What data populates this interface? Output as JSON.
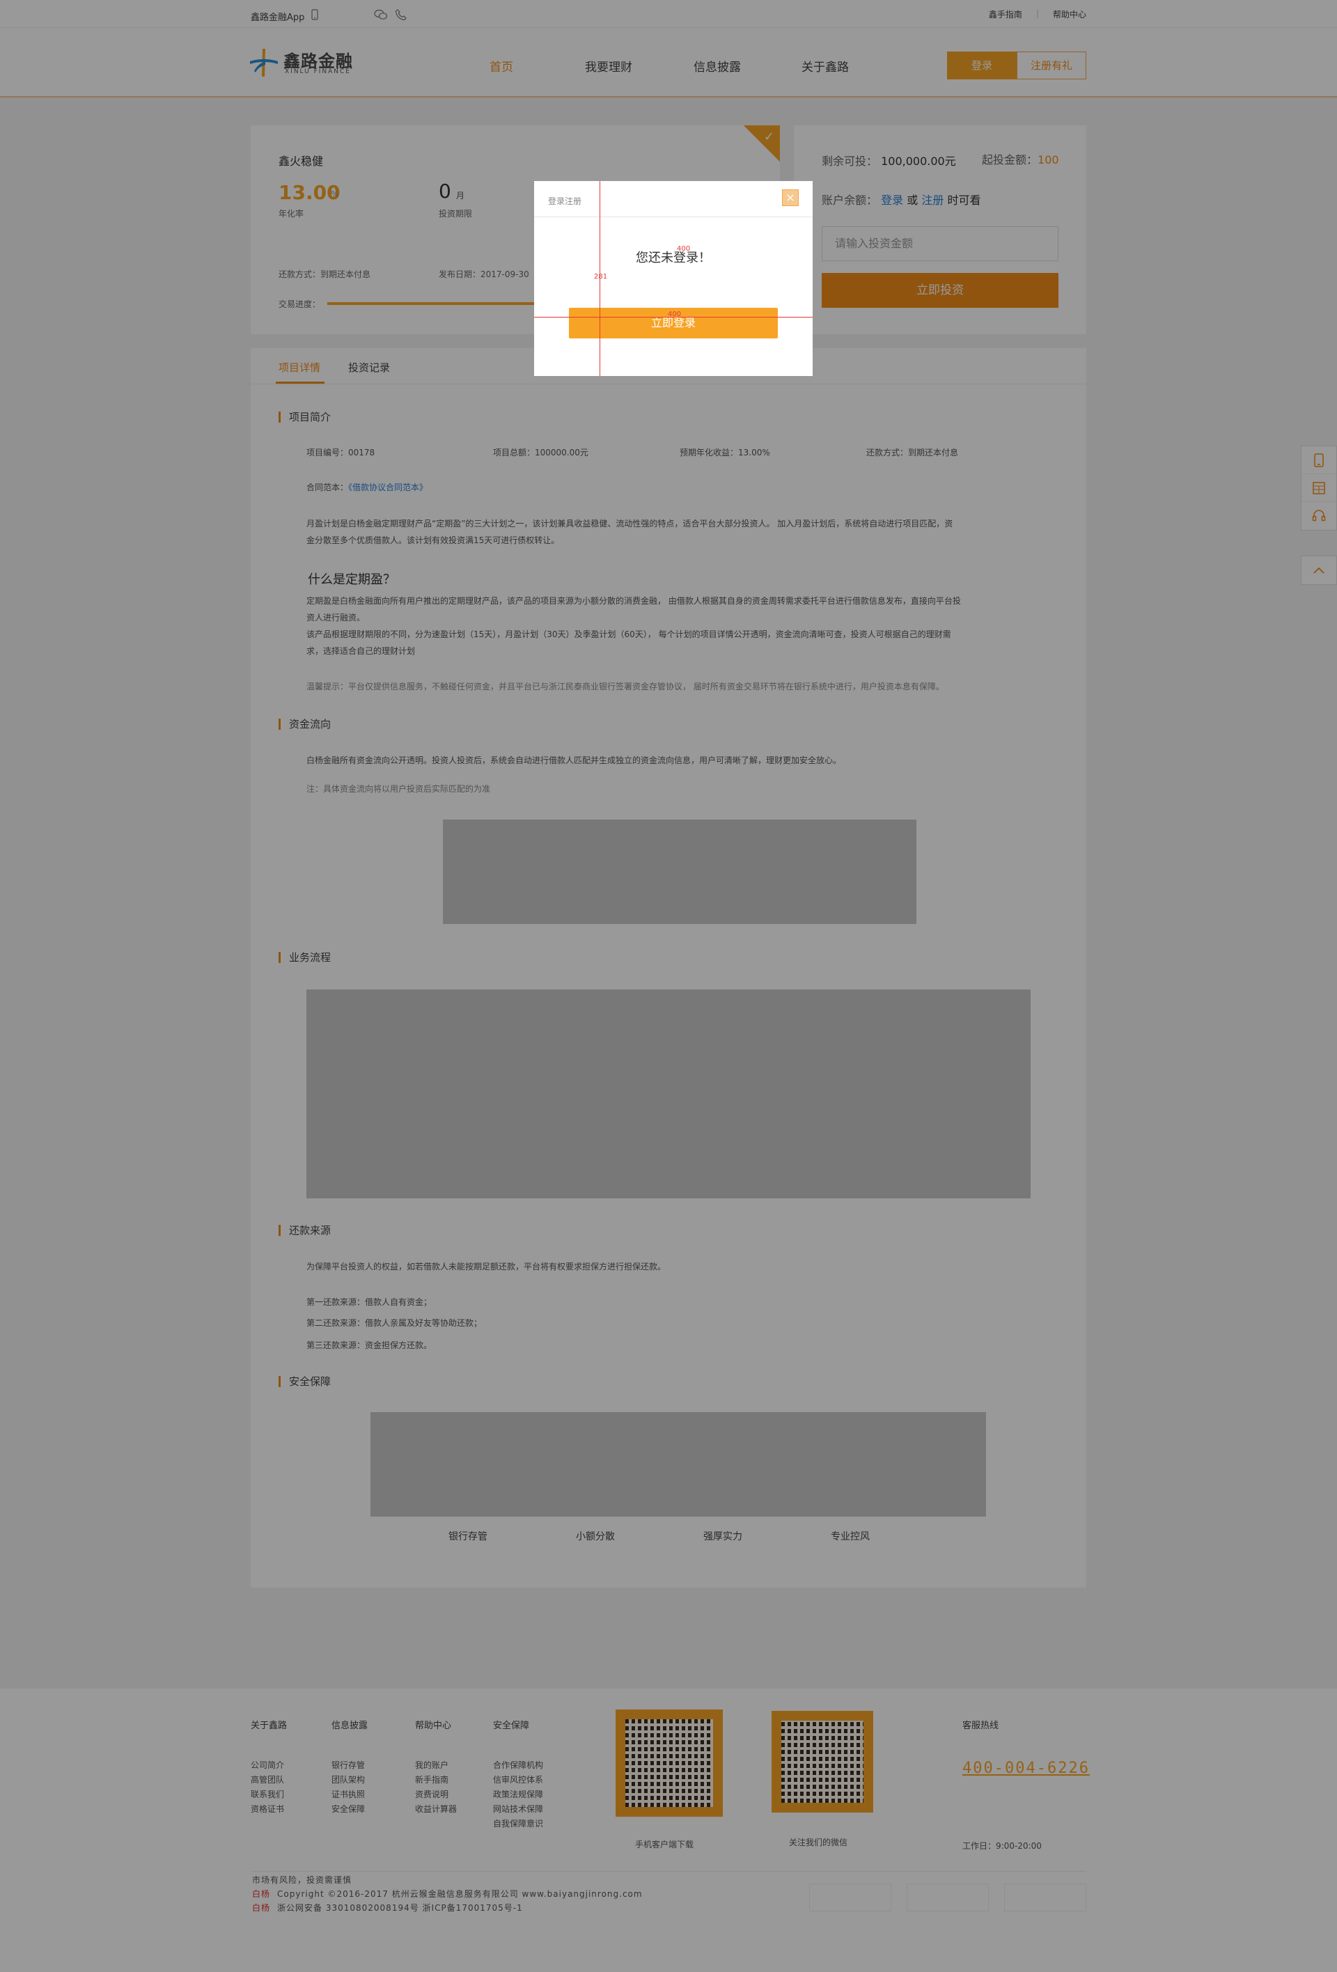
{
  "topbar": {
    "app_label": "鑫路金融App",
    "guide_label": "鑫手指南",
    "help_label": "帮助中心"
  },
  "header": {
    "logo_cn": "鑫路金融",
    "logo_en": "XINLU FINANCE",
    "nav": [
      "首页",
      "我要理财",
      "信息披露",
      "关于鑫路"
    ],
    "login_label": "登录",
    "register_label": "注册有礼"
  },
  "product": {
    "name": "鑫火稳健",
    "rate": "13.00",
    "rate_unit": "%",
    "rate_label": "年化率",
    "term": "0",
    "term_unit": "月",
    "term_label": "投资期限",
    "repay_method": "还款方式：到期还本付息",
    "publish_date": "发布日期：2017-09-30",
    "progress_label": "交易进度：",
    "progress_fraction": 0.7
  },
  "invest": {
    "remaining_label": "剩余可投：",
    "remaining_value": "100,000.00元",
    "min_label": "起投金额：",
    "min_value": "100",
    "balance_label": "账户余额：",
    "login_link": "登录",
    "or": "或",
    "register_link": "注册",
    "visible_suffix": "时可看",
    "input_placeholder": "请输入投资金额",
    "invest_button": "立即投资"
  },
  "tabs": [
    "项目详情",
    "投资记录"
  ],
  "detail": {
    "intro_title": "项目简介",
    "project_no": "项目编号：00178",
    "total": "项目总额：100000.00元",
    "expected_rate": "预期年化收益：13.00%",
    "repay": "还款方式：到期还本付息",
    "contract_label": "合同范本：",
    "contract_link": "《借款协议合同范本》",
    "para1_line1": "月盈计划是白杨金融定期理财产品“定期盈”的三大计划之一，该计划兼具收益稳健、流动性强的特点，适合平台大部分投资人。 加入月盈计划后，系统将自动进行项目匹配，资",
    "para1_line2": "金分散至多个优质借款人。该计划有效投资满15天可进行债权转让。",
    "what_title": "什么是定期盈？",
    "para2_line1": "定期盈是白杨金融面向所有用户推出的定期理财产品，该产品的项目来源为小额分散的消费金融， 由借款人根据其自身的资金周转需求委托平台进行借款信息发布，直接向平台投",
    "para2_line2": "资人进行融资。",
    "para2_line3": "该产品根据理财期限的不同，分为速盈计划（15天），月盈计划（30天）及季盈计划（60天）， 每个计划的项目详情公开透明，资金流向清晰可查，投资人可根据自己的理财需",
    "para2_line4": "求，选择适合自己的理财计划",
    "warm_tip": "温馨提示：平台仅提供信息服务，不触碰任何资金，并且平台已与浙江民泰商业银行签署资金存管协议， 届时所有资金交易环节将在银行系统中进行，用户投资本息有保障。",
    "flow_title": "资金流向",
    "flow_text": "白杨金融所有资金流向公开透明。投资人投资后，系统会自动进行借款人匹配并生成独立的资金流向信息，用户可清晰了解，理财更加安全放心。",
    "flow_note": "注：具体资金流向将以用户投资后实际匹配的为准",
    "process_title": "业务流程",
    "source_title": "还款来源",
    "source_text": "为保障平台投资人的权益，如若借款人未能按期足额还款，平台将有权要求担保方进行担保还款。",
    "source1": "第一还款来源：借款人自有资金；",
    "source2": "第二还款来源：借款人亲属及好友等协助还款；",
    "source3": "第三还款来源：资金担保方还款。",
    "security_title": "安全保障",
    "security_items": [
      "银行存管",
      "小额分散",
      "强厚实力",
      "专业控风"
    ]
  },
  "footer": {
    "cols": [
      {
        "title": "关于鑫路",
        "links": [
          "公司简介",
          "高管团队",
          "联系我们",
          "资格证书"
        ]
      },
      {
        "title": "信息披露",
        "links": [
          "银行存管",
          "团队架构",
          "证书执照",
          "安全保障"
        ]
      },
      {
        "title": "帮助中心",
        "links": [
          "我的账户",
          "新手指南",
          "资费说明",
          "收益计算器"
        ]
      },
      {
        "title": "安全保障",
        "links": [
          "合作保障机构",
          "信审风控体系",
          "政策法规保障",
          "网站技术保障",
          "自我保障意识"
        ]
      }
    ],
    "qr1_caption": "手机客户端下载",
    "qr2_caption": "关注我们的微信",
    "hotline_label": "客服热线",
    "hotline": "400-004-6226",
    "hours": "工作日：9:00-20:00",
    "risk": "市场有风险，投资需谨慎",
    "brand": "白杨",
    "copyright": "Copyright ©2016-2017 杭州云猴金融信息服务有限公司 www.baiyangjinrong.com",
    "icp": "浙公网安备 33010802008194号 浙ICP备17001705号-1"
  },
  "modal": {
    "title": "登录注册",
    "close": "×",
    "message": "您还未登录！",
    "login_button": "立即登录",
    "guide_height_label": "281",
    "guide_width_label": "400",
    "guide_top_label": "400"
  },
  "colors": {
    "accent": "#f7a325",
    "link": "#2a7fd6",
    "overlay": "rgba(0,0,0,0.40)"
  }
}
